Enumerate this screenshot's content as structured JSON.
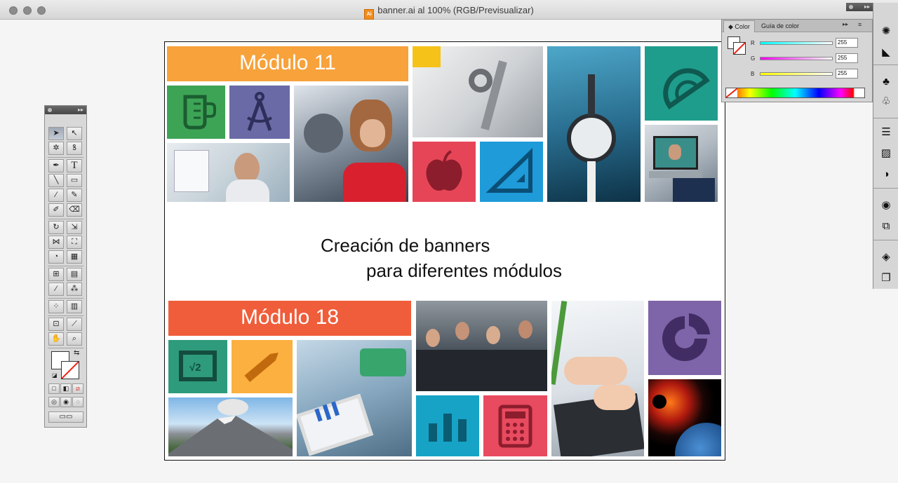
{
  "window": {
    "title": "banner.ai al 100% (RGB/Previsualizar)",
    "file_icon": "ai-file-icon"
  },
  "artboard": {
    "module_a": "Módulo 11",
    "module_b": "Módulo 18",
    "headline_line1": "Creación de banners",
    "headline_line2": "para diferentes módulos",
    "colors": {
      "orange": "#f7a23b",
      "red_orange": "#f05d3a",
      "green": "#3da456",
      "purple": "#6a6aa6",
      "red": "#e64558",
      "blue": "#1e9bd8",
      "teal": "#1f9d8c",
      "teal2": "#2e9b7c",
      "amber": "#fbb040",
      "cyan": "#16a3c6",
      "pink": "#e84a5f",
      "violet": "#7e64a8"
    },
    "icons": [
      "beaker-icon",
      "compass-icon",
      "apple-icon",
      "set-square-icon",
      "protractor-icon",
      "square-root-icon",
      "pencil-icon",
      "bar-chart-icon",
      "calculator-icon",
      "pie-chart-icon"
    ]
  },
  "color_panel": {
    "tabs": [
      "Color",
      "Guía de color"
    ],
    "channels": [
      {
        "label": "R",
        "value": "255"
      },
      {
        "label": "G",
        "value": "255"
      },
      {
        "label": "B",
        "value": "255"
      }
    ]
  },
  "toolbar": {
    "tools": [
      "selection-tool",
      "direct-selection-tool",
      "magic-wand-tool",
      "lasso-tool",
      "pen-tool",
      "type-tool",
      "line-tool",
      "rectangle-tool",
      "paintbrush-tool",
      "pencil-tool",
      "blob-brush-tool",
      "eraser-tool",
      "rotate-tool",
      "scale-tool",
      "width-tool",
      "free-transform-tool",
      "shape-builder-tool",
      "perspective-grid-tool",
      "mesh-tool",
      "gradient-tool",
      "eyedropper-tool",
      "blend-tool",
      "symbol-sprayer-tool",
      "column-graph-tool",
      "artboard-tool",
      "slice-tool",
      "hand-tool",
      "zoom-tool"
    ],
    "type_tool_glyph": "T"
  },
  "dock": {
    "buttons": [
      "brushes-icon",
      "gradient-swatch-icon",
      "symbols-icon",
      "clubs-icon",
      "stroke-icon",
      "gradient-icon",
      "transparency-icon",
      "appearance-icon",
      "graphic-styles-icon",
      "layers-icon",
      "artboards-icon"
    ]
  }
}
